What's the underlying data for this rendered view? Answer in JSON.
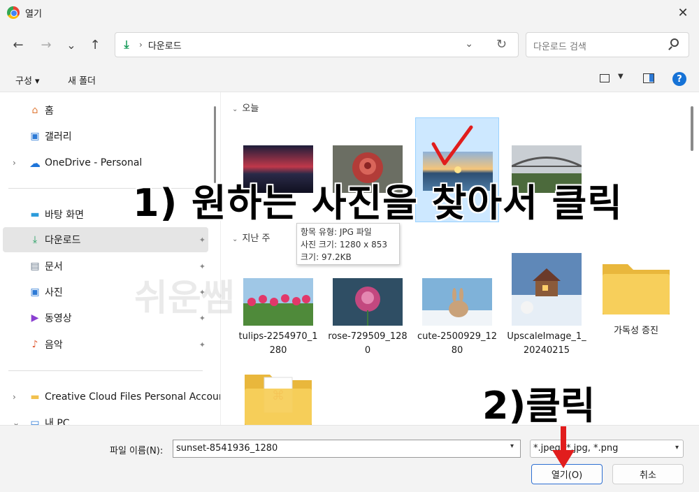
{
  "window": {
    "title": "열기",
    "close_glyph": "✕"
  },
  "nav": {
    "back_glyph": "←",
    "forward_glyph": "→",
    "recent_glyph": "⌄",
    "up_glyph": "↑",
    "address": {
      "icon": "download-icon",
      "sep": "›",
      "crumb": "다운로드",
      "drop_glyph": "⌄",
      "refresh_glyph": "↻"
    },
    "search": {
      "placeholder": "다운로드 검색"
    }
  },
  "toolbar": {
    "organize_label": "구성 ▾",
    "new_folder_label": "새 폴더",
    "view_drop_glyph": "▼",
    "help_glyph": "?"
  },
  "sidebar": {
    "items": [
      {
        "label": "홈",
        "icon": "home-icon",
        "glyph": "⌂",
        "color": "#e07b39"
      },
      {
        "label": "갤러리",
        "icon": "gallery-icon",
        "glyph": "▣",
        "color": "#2d7ad6"
      },
      {
        "label": "OneDrive - Personal",
        "icon": "onedrive-icon",
        "glyph": "☁",
        "color": "#1e74d9",
        "expander": "›"
      },
      {
        "label": "바탕 화면",
        "icon": "desktop-icon",
        "glyph": "▬",
        "color": "#2d9cdb"
      },
      {
        "label": "다운로드",
        "icon": "download-icon",
        "glyph": "⤓",
        "color": "#1a9c5b"
      },
      {
        "label": "문서",
        "icon": "document-icon",
        "glyph": "▤",
        "color": "#6b7b8c"
      },
      {
        "label": "사진",
        "icon": "pictures-icon",
        "glyph": "▣",
        "color": "#2d7ad6"
      },
      {
        "label": "동영상",
        "icon": "video-icon",
        "glyph": "▶",
        "color": "#8a3fd1"
      },
      {
        "label": "음악",
        "icon": "music-icon",
        "glyph": "♪",
        "color": "#e0603a"
      },
      {
        "label": "Creative Cloud Files Personal Account",
        "icon": "folder-icon",
        "glyph": "▬",
        "color": "#f2c14e",
        "expander": "›"
      },
      {
        "label": "내 PC",
        "icon": "pc-icon",
        "glyph": "▭",
        "color": "#2d7ad6",
        "expander": "⌄"
      }
    ],
    "pin_glyph": "📌"
  },
  "content": {
    "groups": [
      {
        "label": "오늘",
        "chev": "⌄"
      },
      {
        "label": "지난 주",
        "chev": "⌄"
      }
    ],
    "today": [
      {
        "label": "...",
        "thumb": "night-sunset"
      },
      {
        "label": "...",
        "thumb": "red-rose"
      },
      {
        "label": "sunset-8541936_1280",
        "thumb": "lake-sunset",
        "selected": true
      },
      {
        "label": "...",
        "thumb": "bridge"
      }
    ],
    "lastweek": [
      {
        "label": "tulips-2254970_1280",
        "thumb": "tulips"
      },
      {
        "label": "rose-729509_1280",
        "thumb": "pink-rose"
      },
      {
        "label": "cute-2500929_1280",
        "thumb": "bunny"
      },
      {
        "label": "UpscaleImage_1_20240215",
        "thumb": "winter-house"
      },
      {
        "label": "가독성 증진",
        "thumb": "folder"
      }
    ],
    "tooltip": [
      "항목 유형: JPG 파일",
      "사진 크기: 1280 x 853",
      "크기: 97.2KB"
    ]
  },
  "bottom": {
    "filename_label": "파일 이름(N):",
    "filename_value": "sunset-8541936_1280",
    "filetype_value": "*.jpeg, *.jpg, *.png",
    "open_label": "열기(O)",
    "cancel_label": "취소",
    "drop_glyph": "▾"
  },
  "annotations": {
    "step1": "1) 원하는 사진을 찾아서 클릭",
    "step2": "2)클릭",
    "watermark": "쉬운쌤",
    "red": "#e11d1d"
  }
}
